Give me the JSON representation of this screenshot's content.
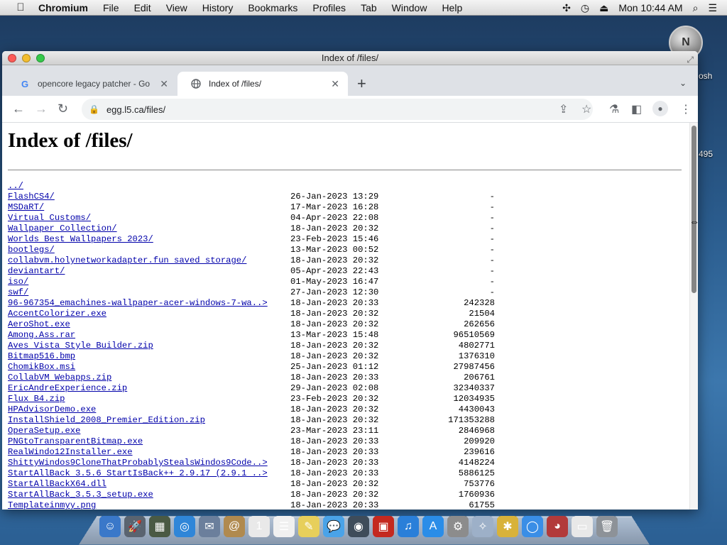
{
  "menubar": {
    "app_name": "Chromium",
    "items": [
      "File",
      "Edit",
      "View",
      "History",
      "Bookmarks",
      "Profiles",
      "Tab",
      "Window",
      "Help"
    ],
    "clock": "Mon 10:44 AM",
    "status_icons": [
      "bluetooth-icon",
      "time-machine-icon",
      "eject-icon",
      "spotlight-icon",
      "list-icon"
    ]
  },
  "desktop": {
    "avatar_letter": "N",
    "label_tosh": "osh",
    "label_495": "495"
  },
  "window": {
    "title": "Index of /files/"
  },
  "tabs": [
    {
      "label": "opencore legacy patcher - Go",
      "favicon": "G",
      "active": false
    },
    {
      "label": "Index of /files/",
      "favicon": "globe-icon",
      "active": true
    }
  ],
  "toolbar": {
    "url": "egg.l5.ca/files/"
  },
  "page": {
    "heading": "Index of /files/",
    "entries": [
      {
        "name": "../",
        "date": "",
        "size": ""
      },
      {
        "name": "FlashCS4/",
        "date": "26-Jan-2023 13:29",
        "size": "-"
      },
      {
        "name": "MSDaRT/",
        "date": "17-Mar-2023 16:28",
        "size": "-"
      },
      {
        "name": "Virtual Customs/",
        "date": "04-Apr-2023 22:08",
        "size": "-"
      },
      {
        "name": "Wallpaper Collection/",
        "date": "18-Jan-2023 20:32",
        "size": "-"
      },
      {
        "name": "Worlds Best Wallpapers 2023/",
        "date": "23-Feb-2023 15:46",
        "size": "-"
      },
      {
        "name": "bootlegs/",
        "date": "13-Mar-2023 00:52",
        "size": "-"
      },
      {
        "name": "collabvm.holynetworkadapter.fun saved storage/",
        "date": "18-Jan-2023 20:32",
        "size": "-"
      },
      {
        "name": "deviantart/",
        "date": "05-Apr-2023 22:43",
        "size": "-"
      },
      {
        "name": "iso/",
        "date": "01-May-2023 16:47",
        "size": "-"
      },
      {
        "name": "swf/",
        "date": "27-Jan-2023 12:30",
        "size": "-"
      },
      {
        "name": "96-967354_emachines-wallpaper-acer-windows-7-wa..>",
        "date": "18-Jan-2023 20:33",
        "size": "242328"
      },
      {
        "name": "AccentColorizer.exe",
        "date": "18-Jan-2023 20:32",
        "size": "21504"
      },
      {
        "name": "AeroShot.exe",
        "date": "18-Jan-2023 20:32",
        "size": "262656"
      },
      {
        "name": "Among.Ass.rar",
        "date": "13-Mar-2023 15:48",
        "size": "96510569"
      },
      {
        "name": "Aves Vista Style Builder.zip",
        "date": "18-Jan-2023 20:32",
        "size": "4802771"
      },
      {
        "name": "Bitmap516.bmp",
        "date": "18-Jan-2023 20:32",
        "size": "1376310"
      },
      {
        "name": "ChomikBox.msi",
        "date": "25-Jan-2023 01:12",
        "size": "27987456"
      },
      {
        "name": "CollabVM Webapps.zip",
        "date": "18-Jan-2023 20:33",
        "size": "206761"
      },
      {
        "name": "EricAndreExperience.zip",
        "date": "29-Jan-2023 02:08",
        "size": "32340337"
      },
      {
        "name": "Flux B4.zip",
        "date": "23-Feb-2023 20:32",
        "size": "12034935"
      },
      {
        "name": "HPAdvisorDemo.exe",
        "date": "18-Jan-2023 20:32",
        "size": "4430043"
      },
      {
        "name": "InstallShield_2008_Premier_Edition.zip",
        "date": "18-Jan-2023 20:32",
        "size": "171353288"
      },
      {
        "name": "OperaSetup.exe",
        "date": "23-Mar-2023 23:11",
        "size": "2846968"
      },
      {
        "name": "PNGtoTransparentBitmap.exe",
        "date": "18-Jan-2023 20:33",
        "size": "209920"
      },
      {
        "name": "RealWindo12Installer.exe",
        "date": "18-Jan-2023 20:33",
        "size": "239616"
      },
      {
        "name": "ShittyWindos9CloneThatProbablyStealsWindos9Code..>",
        "date": "18-Jan-2023 20:33",
        "size": "4148224"
      },
      {
        "name": "StartAllBack 3.5.6 StartIsBack++ 2.9.17 (2.9.1 ..>",
        "date": "18-Jan-2023 20:33",
        "size": "5886125"
      },
      {
        "name": "StartAllBackX64.dll",
        "date": "18-Jan-2023 20:32",
        "size": "753776"
      },
      {
        "name": "StartAllBack_3.5.3_setup.exe",
        "date": "18-Jan-2023 20:32",
        "size": "1760936"
      },
      {
        "name": "Templateinmyy.png",
        "date": "18-Jan-2023 20:33",
        "size": "61755"
      }
    ]
  },
  "dock": {
    "icons": [
      {
        "name": "finder-icon",
        "glyph": "☺",
        "color": "#3a78c9"
      },
      {
        "name": "launchpad-icon",
        "glyph": "🚀",
        "color": "#5a6470"
      },
      {
        "name": "mission-control-icon",
        "glyph": "▦",
        "color": "#4a5a44"
      },
      {
        "name": "safari-icon",
        "glyph": "◎",
        "color": "#2f86d8"
      },
      {
        "name": "mail-icon",
        "glyph": "✉",
        "color": "#6b7f9c"
      },
      {
        "name": "contacts-icon",
        "glyph": "@",
        "color": "#b08a4f"
      },
      {
        "name": "calendar-icon",
        "glyph": "1",
        "color": "#e9e9e9"
      },
      {
        "name": "reminders-icon",
        "glyph": "☰",
        "color": "#f0f0f0"
      },
      {
        "name": "notes-icon",
        "glyph": "✎",
        "color": "#e7cf5b"
      },
      {
        "name": "messages-icon",
        "glyph": "💬",
        "color": "#4aa3e8"
      },
      {
        "name": "facetime-icon",
        "glyph": "◉",
        "color": "#3e4c5a"
      },
      {
        "name": "photo-booth-icon",
        "glyph": "▣",
        "color": "#c4291f"
      },
      {
        "name": "itunes-icon",
        "glyph": "♫",
        "color": "#2a7fd9"
      },
      {
        "name": "app-store-icon",
        "glyph": "A",
        "color": "#2a8de8"
      },
      {
        "name": "system-preferences-icon",
        "glyph": "⚙",
        "color": "#8c8c8c"
      },
      {
        "name": "wizard-icon",
        "glyph": "✧",
        "color": "#9db0c8"
      },
      {
        "name": "bee-icon",
        "glyph": "✱",
        "color": "#d8b23a"
      },
      {
        "name": "chromium-icon",
        "glyph": "◯",
        "color": "#3a8ee6"
      },
      {
        "name": "game-icon",
        "glyph": "◕",
        "color": "#b23a3a"
      },
      {
        "name": "mail-window-icon",
        "glyph": "▭",
        "color": "#e8e8e8"
      },
      {
        "name": "trash-icon",
        "glyph": "🗑",
        "color": "#8d9298"
      }
    ]
  }
}
